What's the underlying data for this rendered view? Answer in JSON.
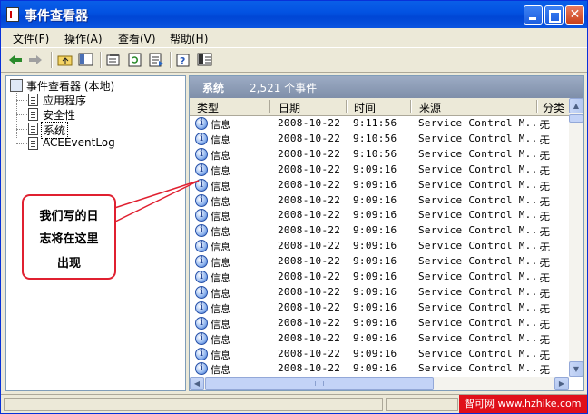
{
  "window": {
    "title": "事件查看器"
  },
  "menu": [
    "文件(F)",
    "操作(A)",
    "查看(V)",
    "帮助(H)"
  ],
  "toolbar": {
    "buttons": [
      "back-icon",
      "forward-icon",
      "up-folder-icon",
      "show-tree-icon",
      "properties-icon",
      "refresh-icon",
      "export-list-icon",
      "help-icon",
      "console-icon"
    ]
  },
  "tree": {
    "root": "事件查看器 (本地)",
    "items": [
      "应用程序",
      "安全性",
      "系统",
      "ACEEventLog"
    ],
    "selected_index": 2
  },
  "log": {
    "title": "系统",
    "count": "2,521 个事件",
    "columns": [
      "类型",
      "日期",
      "时间",
      "来源",
      "分类"
    ],
    "rows": [
      [
        "信息",
        "2008-10-22",
        "9:11:56",
        "Service Control M...",
        "无"
      ],
      [
        "信息",
        "2008-10-22",
        "9:10:56",
        "Service Control M...",
        "无"
      ],
      [
        "信息",
        "2008-10-22",
        "9:10:56",
        "Service Control M...",
        "无"
      ],
      [
        "信息",
        "2008-10-22",
        "9:09:16",
        "Service Control M...",
        "无"
      ],
      [
        "信息",
        "2008-10-22",
        "9:09:16",
        "Service Control M...",
        "无"
      ],
      [
        "信息",
        "2008-10-22",
        "9:09:16",
        "Service Control M...",
        "无"
      ],
      [
        "信息",
        "2008-10-22",
        "9:09:16",
        "Service Control M...",
        "无"
      ],
      [
        "信息",
        "2008-10-22",
        "9:09:16",
        "Service Control M...",
        "无"
      ],
      [
        "信息",
        "2008-10-22",
        "9:09:16",
        "Service Control M...",
        "无"
      ],
      [
        "信息",
        "2008-10-22",
        "9:09:16",
        "Service Control M...",
        "无"
      ],
      [
        "信息",
        "2008-10-22",
        "9:09:16",
        "Service Control M...",
        "无"
      ],
      [
        "信息",
        "2008-10-22",
        "9:09:16",
        "Service Control M...",
        "无"
      ],
      [
        "信息",
        "2008-10-22",
        "9:09:16",
        "Service Control M...",
        "无"
      ],
      [
        "信息",
        "2008-10-22",
        "9:09:16",
        "Service Control M...",
        "无"
      ],
      [
        "信息",
        "2008-10-22",
        "9:09:16",
        "Service Control M...",
        "无"
      ],
      [
        "信息",
        "2008-10-22",
        "9:09:16",
        "Service Control M...",
        "无"
      ],
      [
        "信息",
        "2008-10-22",
        "9:09:16",
        "Service Control M...",
        "无"
      ]
    ]
  },
  "callout": {
    "lines": [
      "我们写的日",
      "志将在这里",
      "出现"
    ]
  },
  "watermark": "智可网 www.hzhike.com",
  "colors": {
    "titlebar": "#0054e3",
    "callout_border": "#e02030",
    "watermark_bg": "#e0101a"
  }
}
